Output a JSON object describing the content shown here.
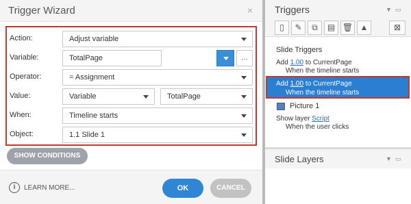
{
  "wizard": {
    "title": "Trigger Wizard",
    "close_glyph": "×",
    "rows": {
      "action": {
        "label": "Action:",
        "value": "Adjust variable"
      },
      "variable": {
        "label": "Variable:",
        "value": "TotalPage",
        "more": "..."
      },
      "operator": {
        "label": "Operator:",
        "value": "= Assignment"
      },
      "value": {
        "label": "Value:",
        "type": "Variable",
        "value": "TotalPage"
      },
      "when": {
        "label": "When:",
        "value": "Timeline starts"
      },
      "object": {
        "label": "Object:",
        "value": "1.1 Slide 1"
      }
    },
    "show_conditions": "SHOW CONDITIONS",
    "learn_more": "LEARN MORE...",
    "info_glyph": "i",
    "ok": "OK",
    "cancel": "CANCEL"
  },
  "triggers_panel": {
    "title": "Triggers",
    "header_icons": [
      "collapse-arrow-icon",
      "undock-window-icon"
    ],
    "toolbar_icons": [
      "new-trigger-icon",
      "edit-trigger-icon",
      "copy-icon",
      "paste-icon",
      "delete-icon",
      "move-up-icon",
      "variables-icon"
    ],
    "slide_triggers_label": "Slide Triggers",
    "triggers": [
      {
        "prefix": "Add",
        "amount": "1.00",
        "middle": "to CurrentPage",
        "when": "When the timeline starts",
        "selected": false
      },
      {
        "prefix": "Add",
        "amount": "1.00",
        "middle": "to CurrentPage",
        "when": "When the timeline starts",
        "selected": true
      }
    ],
    "object_name": "Picture 1",
    "object_trigger": {
      "prefix": "Show layer",
      "link": "Script",
      "when": "When the user clicks"
    },
    "accent_color": "#2a7fd3",
    "highlight_color": "#c0392b"
  },
  "slide_layers": {
    "title": "Slide Layers"
  }
}
